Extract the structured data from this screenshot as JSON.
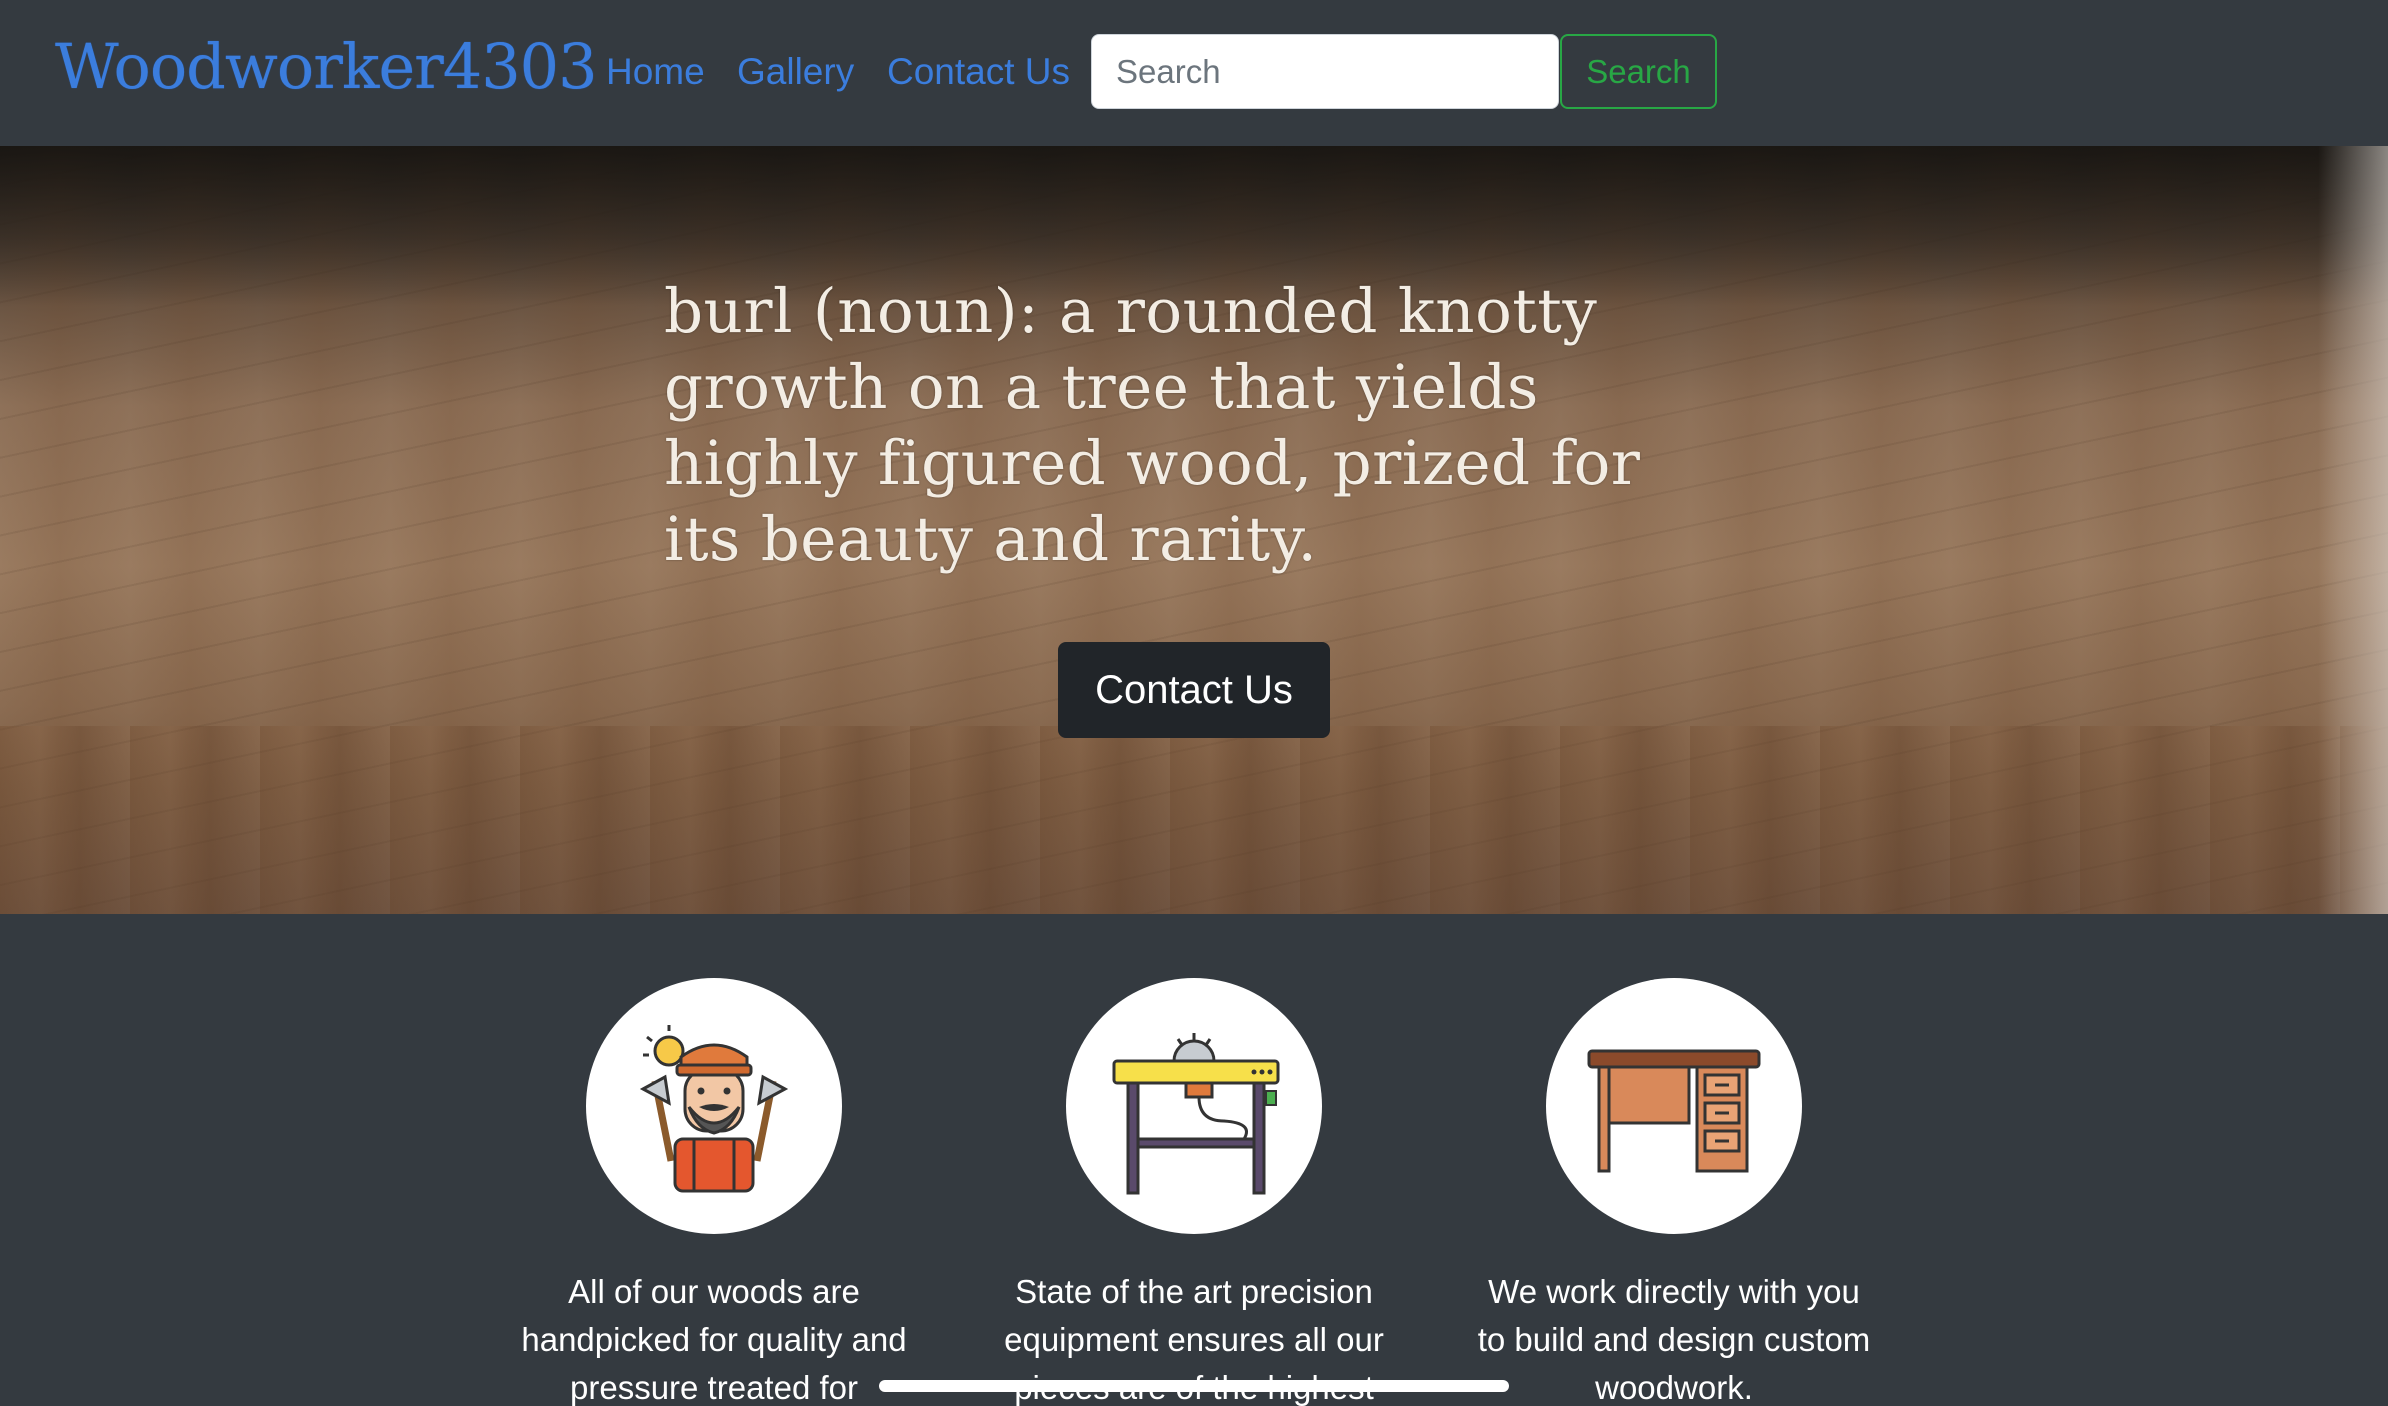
{
  "nav": {
    "brand": "Woodworker4303",
    "links": [
      {
        "label": "Home"
      },
      {
        "label": "Gallery"
      },
      {
        "label": "Contact Us"
      }
    ],
    "search_placeholder": "Search",
    "search_button": "Search"
  },
  "hero": {
    "quote": "burl (noun): a rounded knotty growth on a tree that yields highly figured wood, prized for its beauty and rarity.",
    "button": "Contact Us"
  },
  "features": [
    {
      "icon": "lumberjack-icon",
      "text": "All of our woods are handpicked for quality and pressure treated for"
    },
    {
      "icon": "table-saw-icon",
      "text": "State of the art precision equipment ensures all our pieces are of the highest"
    },
    {
      "icon": "desk-icon",
      "text": "We work directly with you to build and design custom woodwork."
    }
  ],
  "colors": {
    "link": "#3b7ddd",
    "success": "#28a745",
    "navbar_bg": "#343a40",
    "dark_button": "#212529"
  }
}
